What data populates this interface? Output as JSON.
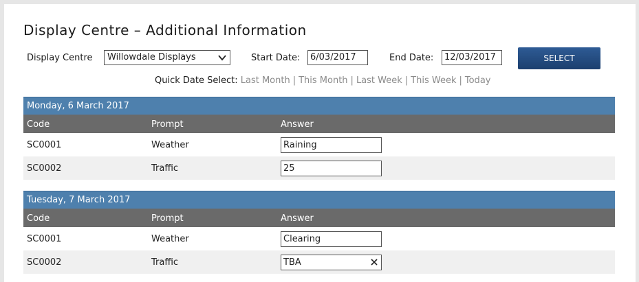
{
  "page": {
    "title": "Display Centre – Additional Information"
  },
  "filters": {
    "display_centre_label": "Display Centre",
    "display_centre_value": "Willowdale Displays",
    "start_date_label": "Start Date:",
    "start_date_value": "6/03/2017",
    "end_date_label": "End Date:",
    "end_date_value": "12/03/2017",
    "select_button": "SELECT"
  },
  "quick_select": {
    "label": "Quick Date Select:",
    "links": [
      "Last Month",
      "This Month",
      "Last Week",
      "This Week",
      "Today"
    ],
    "separator": "|"
  },
  "columns": [
    "Code",
    "Prompt",
    "Answer"
  ],
  "days": [
    {
      "heading": "Monday, 6 March 2017",
      "rows": [
        {
          "code": "SC0001",
          "prompt": "Weather",
          "answer": "Raining"
        },
        {
          "code": "SC0002",
          "prompt": "Traffic",
          "answer": "25"
        }
      ]
    },
    {
      "heading": "Tuesday, 7 March 2017",
      "rows": [
        {
          "code": "SC0001",
          "prompt": "Weather",
          "answer": "Clearing"
        },
        {
          "code": "SC0002",
          "prompt": "Traffic",
          "answer": "TBA"
        }
      ]
    }
  ],
  "icons": {
    "dropdown": "chevron-down-icon",
    "clear": "close-icon"
  },
  "colors": {
    "day_header": "#4e80ad",
    "column_header": "#6a6a6a",
    "button": "#1c3f6e",
    "link": "#8a8a8a"
  }
}
